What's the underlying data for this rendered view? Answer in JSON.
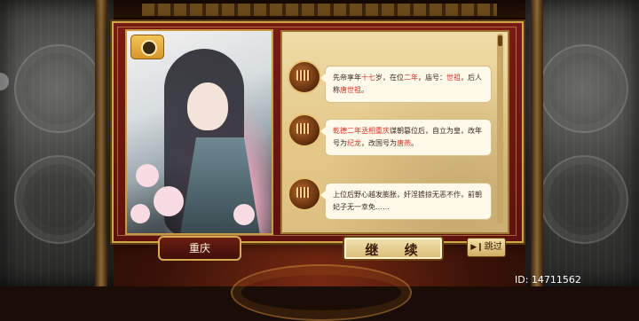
{
  "portrait": {
    "name": "重庆"
  },
  "dialogue": [
    {
      "segments": [
        {
          "text": "先帝享年",
          "hl": false
        },
        {
          "text": "十七",
          "hl": true
        },
        {
          "text": "岁，在位",
          "hl": false
        },
        {
          "text": "二年",
          "hl": true
        },
        {
          "text": "，庙号：",
          "hl": false
        },
        {
          "text": "世祖",
          "hl": true
        },
        {
          "text": "，后人称",
          "hl": false
        },
        {
          "text": "唐世祖",
          "hl": true
        },
        {
          "text": "。",
          "hl": false
        }
      ]
    },
    {
      "segments": [
        {
          "text": "乾德二年丞相重庆",
          "hl": true
        },
        {
          "text": "谋朝篡位后，自立为皇，改年号为",
          "hl": false
        },
        {
          "text": "纪龙",
          "hl": true
        },
        {
          "text": "，改国号为",
          "hl": false
        },
        {
          "text": "唐燕",
          "hl": true
        },
        {
          "text": "。",
          "hl": false
        }
      ]
    },
    {
      "segments": [
        {
          "text": "上位后野心越发膨胀，奸淫掳掠无恶不作，前朝妃子无一幸免……",
          "hl": false
        }
      ]
    }
  ],
  "buttons": {
    "continue_label": "继  续",
    "skip_label": "跳过"
  },
  "footer": {
    "id_text": "ID: 14711562"
  },
  "colors": {
    "highlight": "#d8342a",
    "panel_red": "#7a1a14",
    "gold_border": "#d2a54a"
  },
  "icons": {
    "camera": "camera-icon",
    "skip": "fast-forward-icon"
  }
}
